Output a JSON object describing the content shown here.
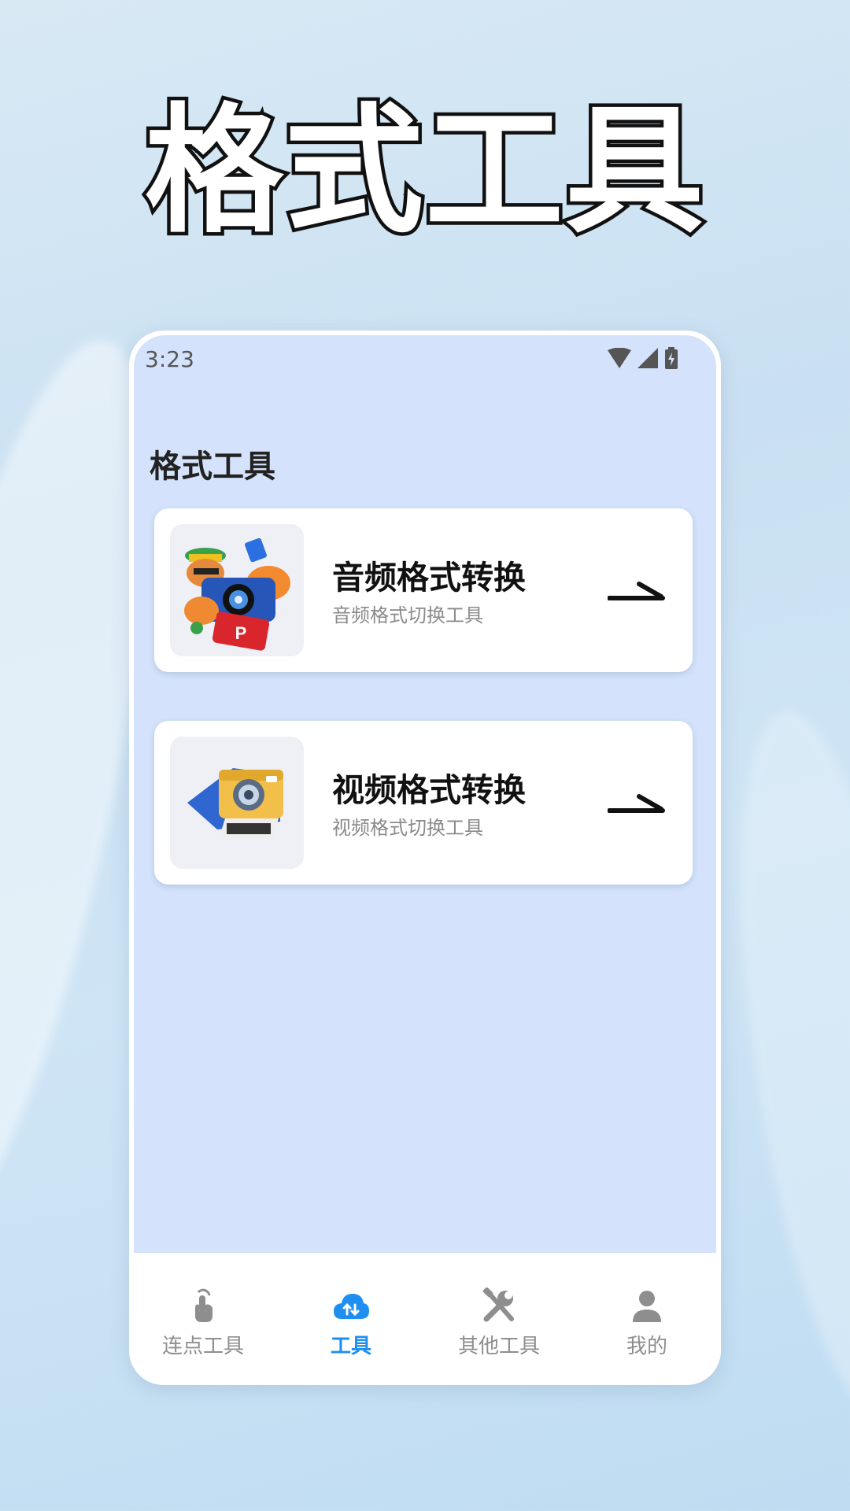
{
  "hero": {
    "title": "格式工具"
  },
  "status_bar": {
    "time": "3:23"
  },
  "page": {
    "heading": "格式工具"
  },
  "cards": [
    {
      "title": "音频格式转换",
      "subtitle": "音频格式切换工具",
      "thumb_icon": "camera-mascot-icon"
    },
    {
      "title": "视频格式转换",
      "subtitle": "视频格式切换工具",
      "thumb_icon": "instant-camera-icon"
    }
  ],
  "tabs": [
    {
      "label": "连点工具",
      "icon": "tap-finger-icon",
      "active": false
    },
    {
      "label": "工具",
      "icon": "cloud-sync-icon",
      "active": true
    },
    {
      "label": "其他工具",
      "icon": "wrench-screwdriver-icon",
      "active": false
    },
    {
      "label": "我的",
      "icon": "person-icon",
      "active": false
    }
  ],
  "colors": {
    "screen_bg": "#d4e3fb",
    "active_tab": "#1e8ff0",
    "inactive_tab": "#8e8e8e"
  }
}
